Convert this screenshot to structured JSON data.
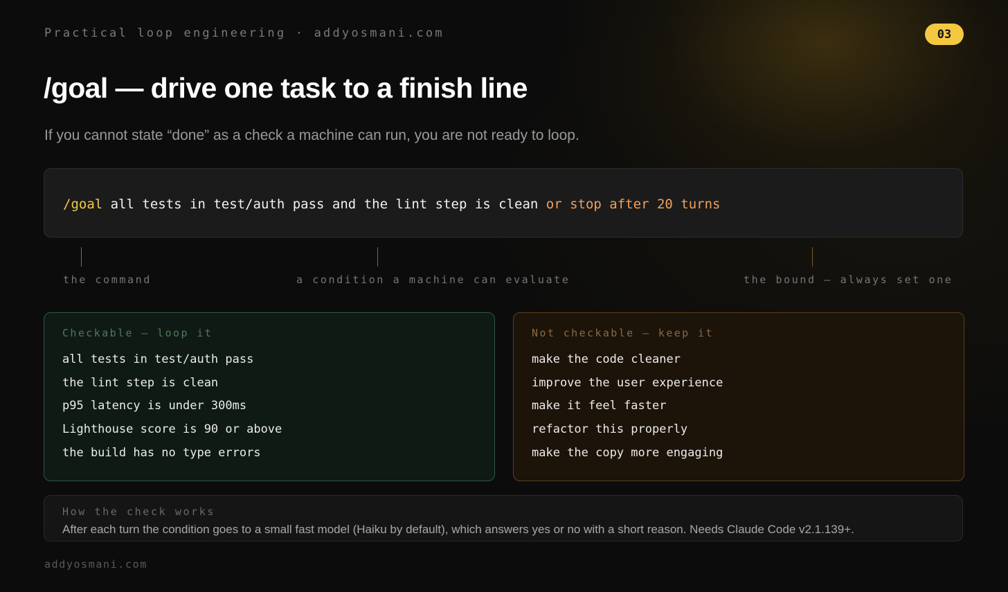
{
  "header": {
    "text": "Practical loop engineering · addyosmani.com",
    "page_number": "03"
  },
  "title": "/goal — drive one task to a finish line",
  "subtitle": "If you cannot state “done” as a check a machine can run, you are not ready to loop.",
  "command": {
    "keyword": "/goal",
    "condition": " all tests in test/auth pass and the lint step is clean ",
    "bound": "or stop after 20 turns"
  },
  "annotations": {
    "command": "the command",
    "condition": "a condition a machine can evaluate",
    "bound": "the bound — always set one"
  },
  "checkable": {
    "heading": "Checkable — loop it",
    "items": [
      "all tests in test/auth pass",
      "the lint step is clean",
      "p95 latency is under 300ms",
      "Lighthouse score is 90 or above",
      "the build has no type errors"
    ]
  },
  "not_checkable": {
    "heading": "Not checkable — keep it",
    "items": [
      "make the code cleaner",
      "improve the user experience",
      "make it feel faster",
      "refactor this properly",
      "make the copy more engaging"
    ]
  },
  "note": {
    "heading": "How the check works",
    "text": "After each turn the condition goes to a small fast model (Haiku by default), which answers yes or no with a short reason. Needs Claude Code v2.1.139+."
  },
  "footer": "addyosmani.com",
  "colors": {
    "accent": "#f5c842",
    "command_keyword": "#f2c94c",
    "command_bound": "#f0a25a",
    "checkable_border": "#2e5a40",
    "not_checkable_border": "#5c4020"
  }
}
